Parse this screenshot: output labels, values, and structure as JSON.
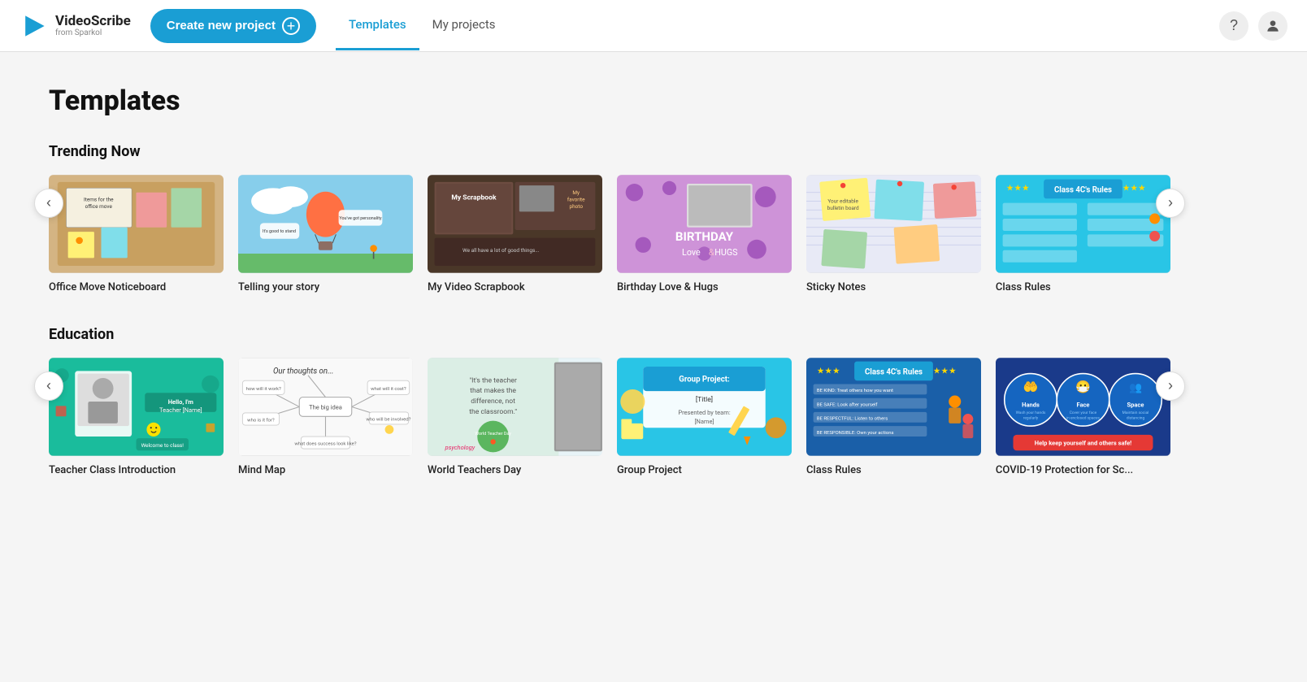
{
  "header": {
    "logo_main": "VideoScribe",
    "logo_sub": "from Sparkol",
    "create_label": "Create new project",
    "nav_tabs": [
      {
        "label": "Templates",
        "active": true
      },
      {
        "label": "My projects",
        "active": false
      }
    ]
  },
  "page": {
    "title": "Templates",
    "sections": [
      {
        "id": "trending",
        "title": "Trending Now",
        "templates": [
          {
            "id": "office",
            "name": "Office Move Noticeboard",
            "bg": "#c8a96e",
            "theme": "office"
          },
          {
            "id": "story",
            "name": "Telling your story",
            "bg": "#87ceeb",
            "theme": "story"
          },
          {
            "id": "scrapbook",
            "name": "My Video Scrapbook",
            "bg": "#5a4030",
            "theme": "scrapbook"
          },
          {
            "id": "birthday",
            "name": "Birthday Love & Hugs",
            "bg": "#c890e8",
            "theme": "birthday"
          },
          {
            "id": "sticky",
            "name": "Sticky Notes",
            "bg": "#eef2ff",
            "theme": "sticky"
          },
          {
            "id": "classrules",
            "name": "Class Rules",
            "bg": "#29c5e6",
            "theme": "classrules"
          }
        ]
      },
      {
        "id": "education",
        "title": "Education",
        "templates": [
          {
            "id": "teacher",
            "name": "Teacher Class Introduction",
            "bg": "#1abc9c",
            "theme": "teacher"
          },
          {
            "id": "mindmap",
            "name": "Mind Map",
            "bg": "#f8f8f8",
            "theme": "mindmap"
          },
          {
            "id": "worldteacher",
            "name": "World Teachers Day",
            "bg": "#d4eaf5",
            "theme": "worldteacher"
          },
          {
            "id": "group",
            "name": "Group Project",
            "bg": "#29c5e6",
            "theme": "group"
          },
          {
            "id": "classrules2",
            "name": "Class Rules",
            "bg": "#1a5fa8",
            "theme": "classrules2"
          },
          {
            "id": "covid",
            "name": "COVID-19 Protection for Sc...",
            "bg": "#1a3a8a",
            "theme": "covid"
          }
        ]
      }
    ]
  }
}
